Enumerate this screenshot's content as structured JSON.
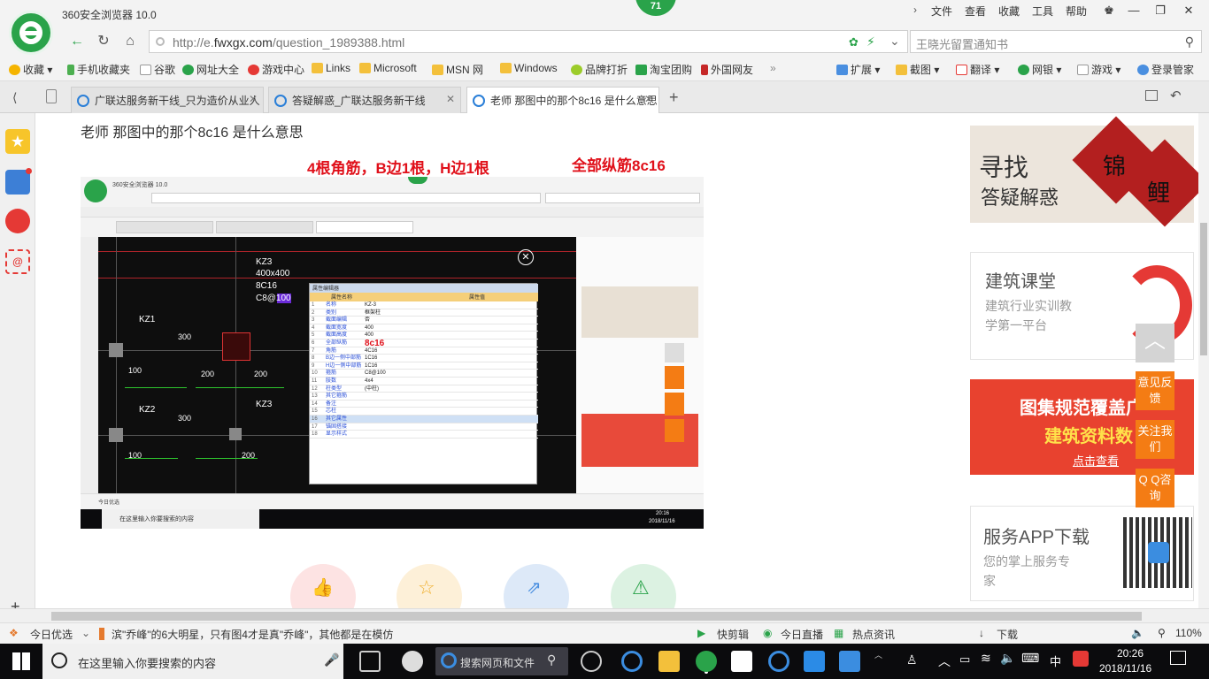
{
  "window": {
    "title": "360安全浏览器 10.0",
    "badge": "71",
    "menu": [
      "文件",
      "查看",
      "收藏",
      "工具",
      "帮助"
    ],
    "controls": {
      "skin": "♚",
      "min": "—",
      "max": "❐",
      "close": "✕"
    }
  },
  "nav": {
    "back": "←",
    "refresh": "↻",
    "home": "⌂",
    "url_prefix": "http://e.",
    "url_domain": "fwxgx.com",
    "url_path": "/question_1989388.html",
    "search_value": "王晓光留置通知书"
  },
  "bookmarks": [
    "收藏",
    "手机收藏夹",
    "谷歌",
    "网址大全",
    "游戏中心",
    "Links",
    "Microsoft",
    "MSN 网",
    "Windows",
    "品牌打折",
    "淘宝团购",
    "外国网友"
  ],
  "toolbar_right": [
    "扩展",
    "截图",
    "翻译",
    "网银",
    "游戏",
    "登录管家"
  ],
  "tabs": [
    {
      "label": "广联达服务新干线_只为造价从业人"
    },
    {
      "label": "答疑解惑_广联达服务新干线"
    },
    {
      "label": "老师 那图中的那个8c16 是什么意思"
    }
  ],
  "question": {
    "text": "老师  那图中的那个8c16 是什么意思",
    "ann_left": "4根角筋，B边1根，H边1根",
    "ann_right": "全部纵筋8c16"
  },
  "shot": {
    "labels": {
      "kz3": "KZ3",
      "size": "400x400",
      "main": "8C16",
      "stirrup": "C8@100",
      "kz1": "KZ1",
      "kz2": "KZ2",
      "kz3b": "KZ3",
      "d300a": "300",
      "d300b": "300",
      "d100a": "100",
      "d100b": "100",
      "d200a": "200",
      "d200b": "200",
      "d200c": "200",
      "highlight": "8c16"
    },
    "panel_title": "属性编辑器",
    "col_name": "属性名称",
    "col_value": "属性值",
    "rows": [
      "名称",
      "类别",
      "截面编辑",
      "截面宽度",
      "截面高度",
      "全部纵筋",
      "角筋",
      "B边一侧中部筋",
      "H边一侧中部筋",
      "箍筋",
      "肢数",
      "柱类型",
      "其它箍筋",
      "备注",
      "芯柱",
      "其它属性",
      "锚固搭接",
      "显示样式"
    ],
    "values": [
      "KZ-3",
      "框架柱",
      "否",
      "400",
      "400",
      "",
      "4C16",
      "1C16",
      "1C16",
      "C8@100",
      "4x4",
      "(中柱)",
      "",
      "",
      "",
      "",
      "",
      ""
    ],
    "taskbar_search": "在这里输入你要搜索的内容",
    "clock": "20:16",
    "date": "2018/11/16",
    "status": "今日优选"
  },
  "sidebar_right": {
    "ad1_line1": "寻找",
    "ad1_line2": "答疑解惑",
    "ad1_char1": "锦",
    "ad1_char2": "鲤",
    "course_title": "建筑课堂",
    "course_sub1": "建筑行业实训教",
    "course_sub2": "学第一平台",
    "ad2_line1": "图集规范覆盖广",
    "ad2_line2": "建筑资料数",
    "ad2_link": "点击查看",
    "app_title": "服务APP下载",
    "app_sub1": "您的掌上服务专",
    "app_sub2": "家"
  },
  "float": {
    "feedback": "意见反馈",
    "follow": "关注我们",
    "qq": "Q Q咨询"
  },
  "status": {
    "news_label": "今日优选",
    "news": "滨\"乔峰\"的6大明星，只有图4才是真\"乔峰\"，其他都是在模仿",
    "kuaijian": "快剪辑",
    "live": "今日直播",
    "hot": "热点资讯",
    "download": "下载",
    "zoom": "110%"
  },
  "taskbar": {
    "search": "在这里输入你要搜索的内容",
    "webfile": "搜索网页和文件",
    "ime": "中",
    "time": "20:26",
    "date": "2018/11/16"
  },
  "colors": {
    "green": "#2aa34a",
    "orange": "#f47c14",
    "red": "#e0101a",
    "taskbar": "#0b0b0d"
  }
}
